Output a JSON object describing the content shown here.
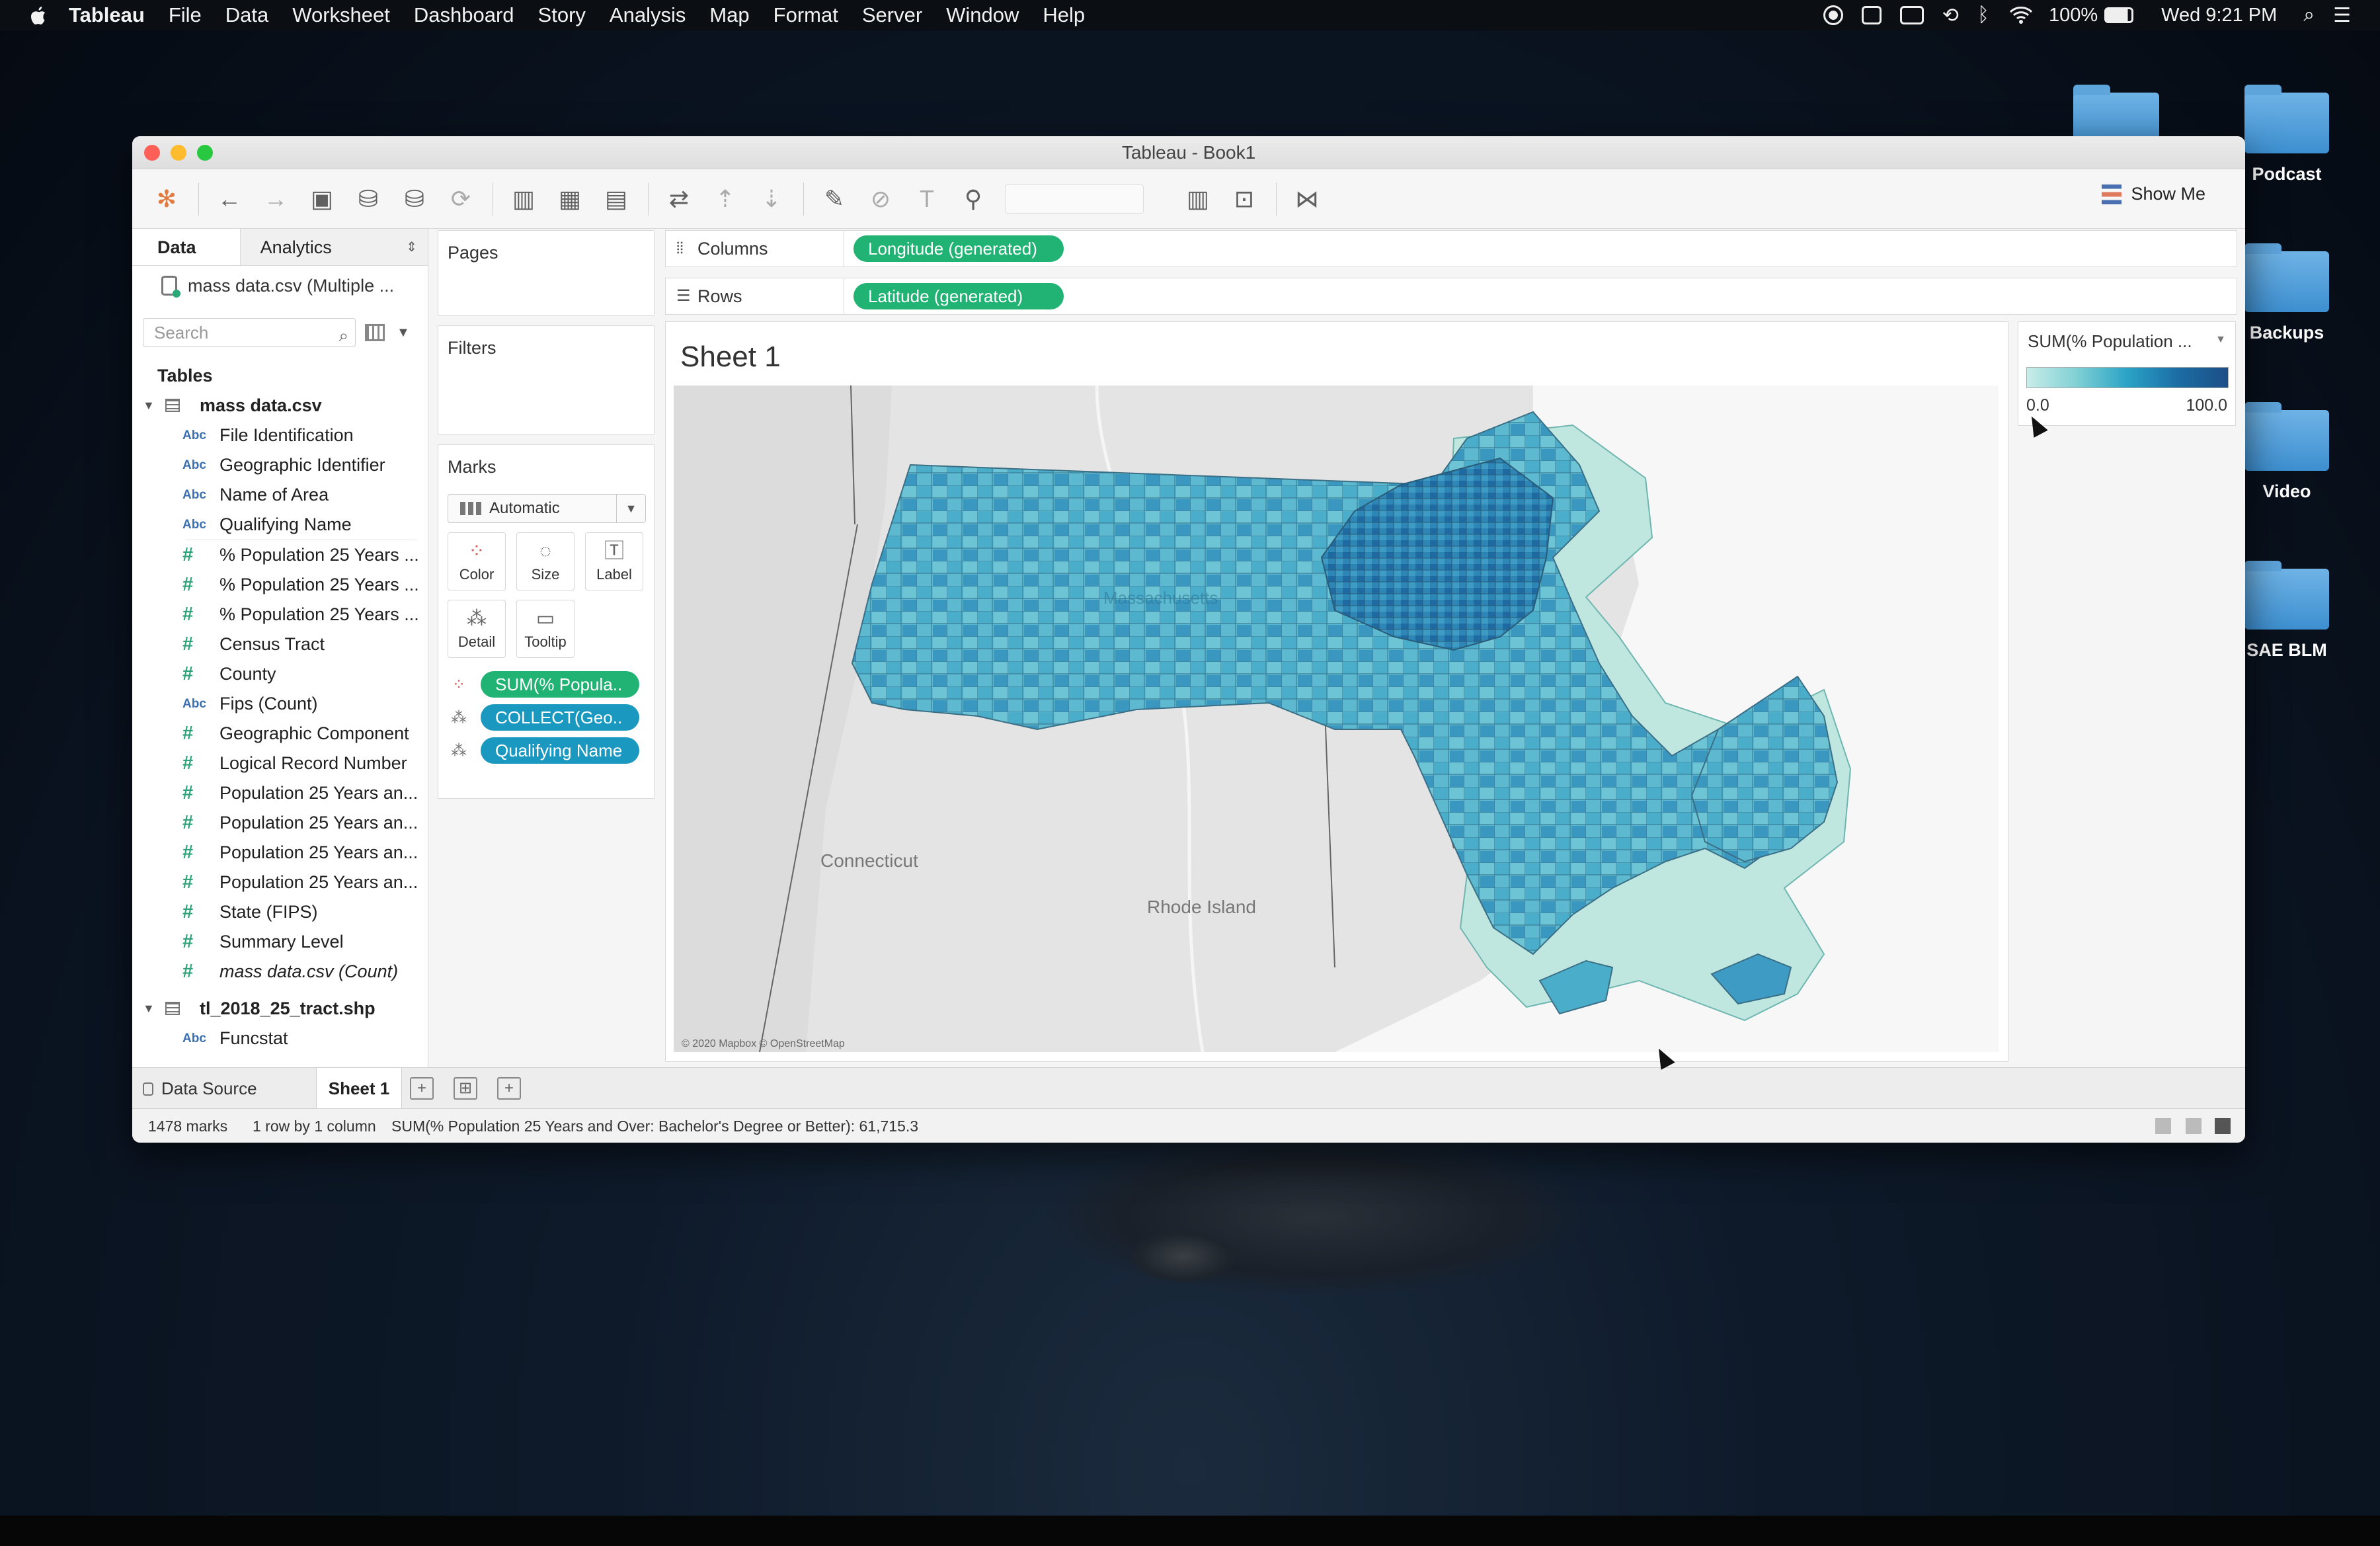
{
  "menubar": {
    "app": "Tableau",
    "items": [
      "File",
      "Data",
      "Worksheet",
      "Dashboard",
      "Story",
      "Analysis",
      "Map",
      "Format",
      "Server",
      "Window",
      "Help"
    ],
    "battery": "100%",
    "clock": "Wed 9:21 PM",
    "status_icons": [
      "record-icon",
      "notification-icon",
      "display-icon",
      "time-machine-icon",
      "bluetooth-icon",
      "wifi-icon",
      "battery-icon",
      "spotlight-icon",
      "control-center-icon"
    ]
  },
  "desktop": {
    "folders": [
      "Podcast",
      "Backups",
      "Video",
      "SAE BLM"
    ]
  },
  "window": {
    "title": "Tableau - Book1",
    "show_me": "Show Me"
  },
  "datapane": {
    "tabs": [
      "Data",
      "Analytics"
    ],
    "source": "mass data.csv (Multiple ...",
    "search_placeholder": "Search",
    "tables_header": "Tables",
    "table1": {
      "name": "mass data.csv",
      "fields": [
        {
          "type": "Abc",
          "name": "File Identification"
        },
        {
          "type": "Abc",
          "name": "Geographic Identifier"
        },
        {
          "type": "Abc",
          "name": "Name of Area"
        },
        {
          "type": "Abc",
          "name": "Qualifying Name"
        },
        {
          "type": "#",
          "name": "% Population 25 Years ..."
        },
        {
          "type": "#",
          "name": "% Population 25 Years ..."
        },
        {
          "type": "#",
          "name": "% Population 25 Years ..."
        },
        {
          "type": "#",
          "name": "Census Tract"
        },
        {
          "type": "#",
          "name": "County"
        },
        {
          "type": "Abc",
          "name": "Fips (Count)"
        },
        {
          "type": "#",
          "name": "Geographic Component"
        },
        {
          "type": "#",
          "name": "Logical Record Number"
        },
        {
          "type": "#",
          "name": "Population 25 Years an..."
        },
        {
          "type": "#",
          "name": "Population 25 Years an..."
        },
        {
          "type": "#",
          "name": "Population 25 Years an..."
        },
        {
          "type": "#",
          "name": "Population 25 Years an..."
        },
        {
          "type": "#",
          "name": "State (FIPS)"
        },
        {
          "type": "#",
          "name": "Summary Level"
        },
        {
          "type": "#",
          "name": "mass data.csv (Count)"
        }
      ]
    },
    "table2": {
      "name": "tl_2018_25_tract.shp",
      "fields": [
        {
          "type": "Abc",
          "name": "Funcstat"
        }
      ]
    }
  },
  "cards": {
    "pages": "Pages",
    "filters": "Filters",
    "marks": "Marks",
    "mark_type": "Automatic",
    "buttons": [
      "Color",
      "Size",
      "Label",
      "Detail",
      "Tooltip"
    ],
    "mark_pills": [
      "SUM(% Popula..",
      "COLLECT(Geo..",
      "Qualifying Name"
    ]
  },
  "shelves": {
    "columns_label": "Columns",
    "columns_pill": "Longitude (generated)",
    "rows_label": "Rows",
    "rows_pill": "Latitude (generated)"
  },
  "view": {
    "sheet_title": "Sheet 1",
    "map_labels": {
      "connecticut": "Connecticut",
      "rhode_island": "Rhode Island",
      "massachusetts": "Massachusetts"
    },
    "attribution": "© 2020 Mapbox © OpenStreetMap"
  },
  "legend": {
    "title": "SUM(% Population ...",
    "min": "0.0",
    "max": "100.0",
    "colors": [
      "#c8ece8",
      "#7fd0d4",
      "#2aa3c6",
      "#1b6da4",
      "#1d4e86"
    ]
  },
  "tabs": {
    "data_source": "Data Source",
    "sheet": "Sheet 1"
  },
  "status": {
    "marks": "1478 marks",
    "dims": "1 row by 1 column",
    "sum": "SUM(% Population 25 Years and Over: Bachelor's Degree or Better): 61,715.3"
  }
}
